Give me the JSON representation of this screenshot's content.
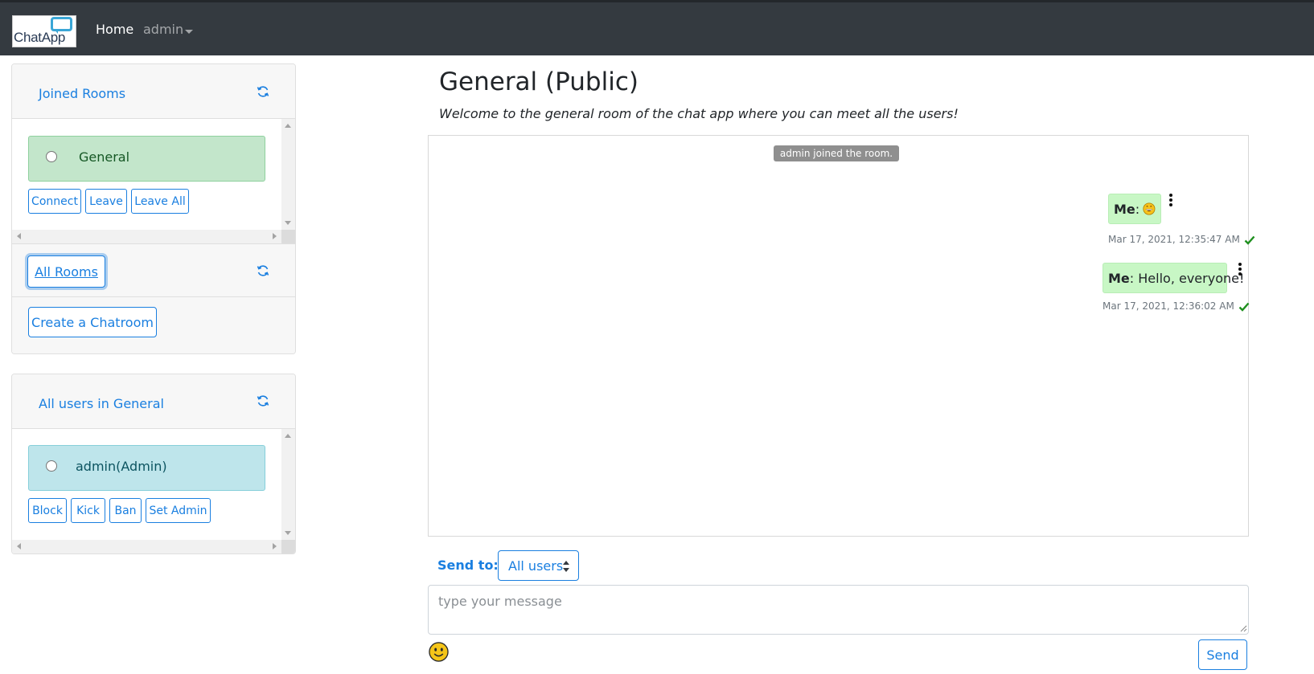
{
  "navbar": {
    "logo_text": "ChatApp",
    "home_label": "Home",
    "user_label": "admin"
  },
  "joined_rooms": {
    "title": "Joined Rooms",
    "items": [
      {
        "label": "General"
      }
    ],
    "buttons": {
      "connect": "Connect",
      "leave": "Leave",
      "leave_all": "Leave All"
    }
  },
  "all_rooms": {
    "link_label": "All Rooms",
    "create_label": "Create a Chatroom"
  },
  "users_panel": {
    "title": "All users in General",
    "items": [
      {
        "label": "admin(Admin)"
      }
    ],
    "buttons": {
      "block": "Block",
      "kick": "Kick",
      "ban": "Ban",
      "set_admin": "Set Admin"
    }
  },
  "room": {
    "title": "General (Public)",
    "description": "Welcome to the general room of the chat app where you can meet all the users!"
  },
  "chat": {
    "system_message": "admin joined the room.",
    "messages": [
      {
        "sender": "Me",
        "text": "",
        "emoji": "grinning-face",
        "time": "Mar 17, 2021, 12:35:47 AM"
      },
      {
        "sender": "Me",
        "text": " Hello, everyone!",
        "time": "Mar 17, 2021, 12:36:02 AM"
      }
    ]
  },
  "composer": {
    "send_to_label": "Send to:",
    "recipient": "All users",
    "placeholder": "type your message",
    "send_label": "Send"
  },
  "colors": {
    "navbar_bg": "#343a40",
    "primary": "#1a7fe0",
    "joined_item_bg": "#c3e6cb",
    "user_item_bg": "#bee5eb",
    "message_bg": "#c8f7c5",
    "check_color": "#1e8f1e"
  }
}
